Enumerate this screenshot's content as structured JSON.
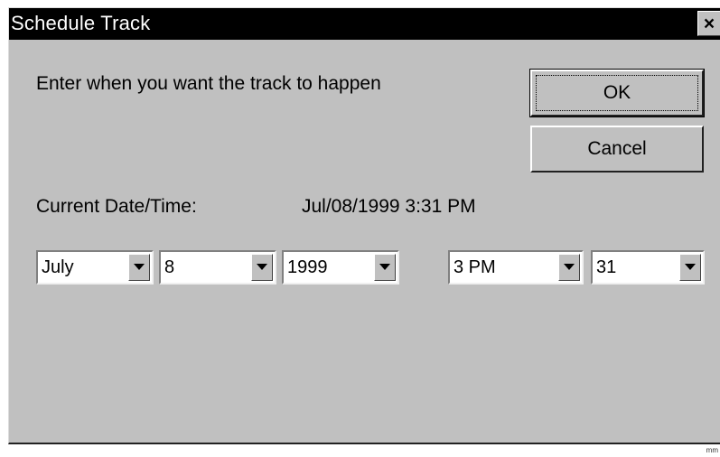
{
  "window": {
    "title": "Schedule Track",
    "close_label": "×"
  },
  "dialog": {
    "prompt": "Enter when you want the track to happen",
    "current_label": "Current Date/Time:",
    "current_value": "Jul/08/1999 3:31 PM"
  },
  "buttons": {
    "ok_label": "OK",
    "cancel_label": "Cancel"
  },
  "fields": {
    "month": "July",
    "day": "8",
    "year": "1999",
    "hour": "3 PM",
    "minute": "31"
  },
  "footer": {
    "mark": "mm"
  }
}
